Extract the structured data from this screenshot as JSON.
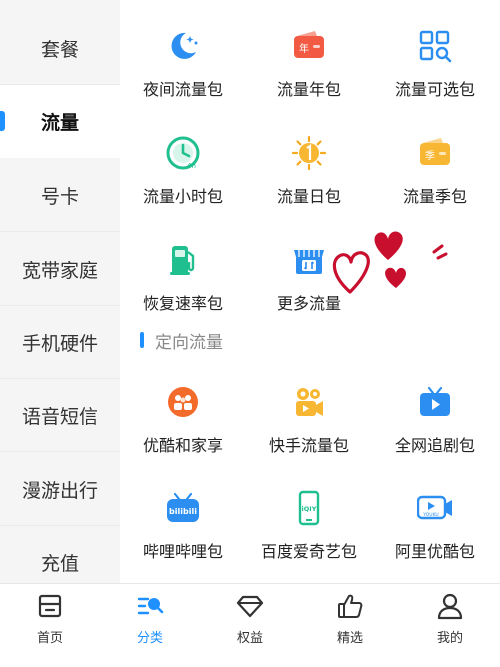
{
  "sidebar": {
    "items": [
      {
        "label": "套餐",
        "active": false
      },
      {
        "label": "流量",
        "active": true
      },
      {
        "label": "号卡",
        "active": false
      },
      {
        "label": "宽带家庭",
        "active": false
      },
      {
        "label": "手机硬件",
        "active": false
      },
      {
        "label": "语音短信",
        "active": false
      },
      {
        "label": "漫游出行",
        "active": false
      },
      {
        "label": "充值",
        "active": false
      }
    ]
  },
  "products": [
    {
      "label": "夜间流量包",
      "icon": "moon-stars-icon"
    },
    {
      "label": "流量年包",
      "icon": "red-wallet-year-icon"
    },
    {
      "label": "流量可选包",
      "icon": "grid-search-icon"
    },
    {
      "label": "流量小时包",
      "icon": "clock-4h-icon"
    },
    {
      "label": "流量日包",
      "icon": "sun-icon"
    },
    {
      "label": "流量季包",
      "icon": "yellow-wallet-season-icon"
    },
    {
      "label": "恢复速率包",
      "icon": "fuel-pump-icon"
    },
    {
      "label": "更多流量",
      "icon": "store-icon"
    }
  ],
  "product_icon_text": {
    "year": "年",
    "season": "季",
    "hour": "4h"
  },
  "section": {
    "title": "定向流量"
  },
  "directed": [
    {
      "label": "优酷和家享",
      "icon": "family-group-icon"
    },
    {
      "label": "快手流量包",
      "icon": "video-camera-icon"
    },
    {
      "label": "全网追剧包",
      "icon": "tv-play-icon"
    },
    {
      "label": "哔哩哔哩包",
      "icon": "bilibili-icon"
    },
    {
      "label": "百度爱奇艺包",
      "icon": "iqiyi-phone-icon"
    },
    {
      "label": "阿里优酷包",
      "icon": "youku-icon"
    }
  ],
  "directed_icon_text": {
    "bilibili": "bilibili",
    "iqiyi": "iQIY",
    "youku": "YOUKU"
  },
  "bottom_nav": [
    {
      "label": "首页",
      "icon": "home-icon",
      "active": false
    },
    {
      "label": "分类",
      "icon": "category-search-icon",
      "active": true
    },
    {
      "label": "权益",
      "icon": "diamond-icon",
      "active": false
    },
    {
      "label": "精选",
      "icon": "thumbs-up-icon",
      "active": false
    },
    {
      "label": "我的",
      "icon": "person-icon",
      "active": false
    }
  ],
  "colors": {
    "accent": "#1e90ff",
    "sidebar_bg": "#f5f5f5",
    "hearts": "#c8102e"
  }
}
